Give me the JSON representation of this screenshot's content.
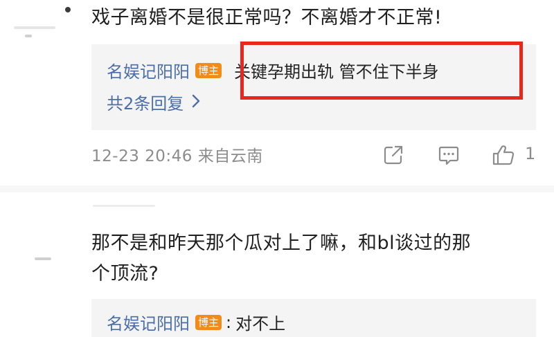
{
  "comments": [
    {
      "text": "戏子离婚不是很正常吗？不离婚才不正常!",
      "reply_user": "名娱记阳阳",
      "reply_badge": "博主",
      "reply_text": "关键孕期出轨 管不住下半身",
      "more_replies": "共2条回复",
      "meta": "12-23 20:46 来自云南",
      "like_count": "1"
    },
    {
      "text_line1": "那不是和昨天那个瓜对上了嘛，和bl谈过的那",
      "text_line2": "个顶流?",
      "reply_user": "名娱记阳阳",
      "reply_badge": "博主",
      "reply_colon": ":",
      "reply_text": "对不上"
    }
  ],
  "colors": {
    "username": "#4a6ea9",
    "badge": "#f28b1a",
    "highlight": "#e8281e",
    "meta": "#8c8c8c"
  },
  "icons": [
    "share-icon",
    "comment-icon",
    "thumbs-up-icon",
    "chevron-right-icon"
  ]
}
